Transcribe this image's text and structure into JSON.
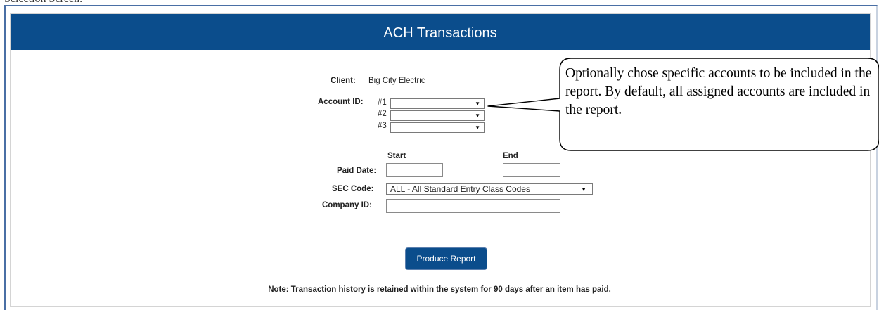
{
  "header": {
    "title": "ACH Transactions"
  },
  "client": {
    "label": "Client:",
    "value": "Big City Electric"
  },
  "account": {
    "label": "Account ID:",
    "slots": [
      {
        "num": "#1",
        "value": ""
      },
      {
        "num": "#2",
        "value": ""
      },
      {
        "num": "#3",
        "value": ""
      }
    ]
  },
  "dates": {
    "start_label": "Start",
    "end_label": "End",
    "paid_label": "Paid Date:",
    "start_value": "",
    "end_value": ""
  },
  "sec_code": {
    "label": "SEC Code:",
    "value": "ALL - All Standard Entry Class Codes"
  },
  "company": {
    "label": "Company ID:",
    "value": ""
  },
  "actions": {
    "produce_label": "Produce Report"
  },
  "note": "Note: Transaction history is retained within the system for 90 days after an item has paid.",
  "callout": {
    "text": "Optionally chose specific accounts to be included in the report.  By default, all assigned accounts are included in the report."
  },
  "colors": {
    "brand": "#0b4d8c",
    "frame": "#4a6fa5"
  },
  "icons": {
    "dropdown": "chevron-down-icon"
  }
}
